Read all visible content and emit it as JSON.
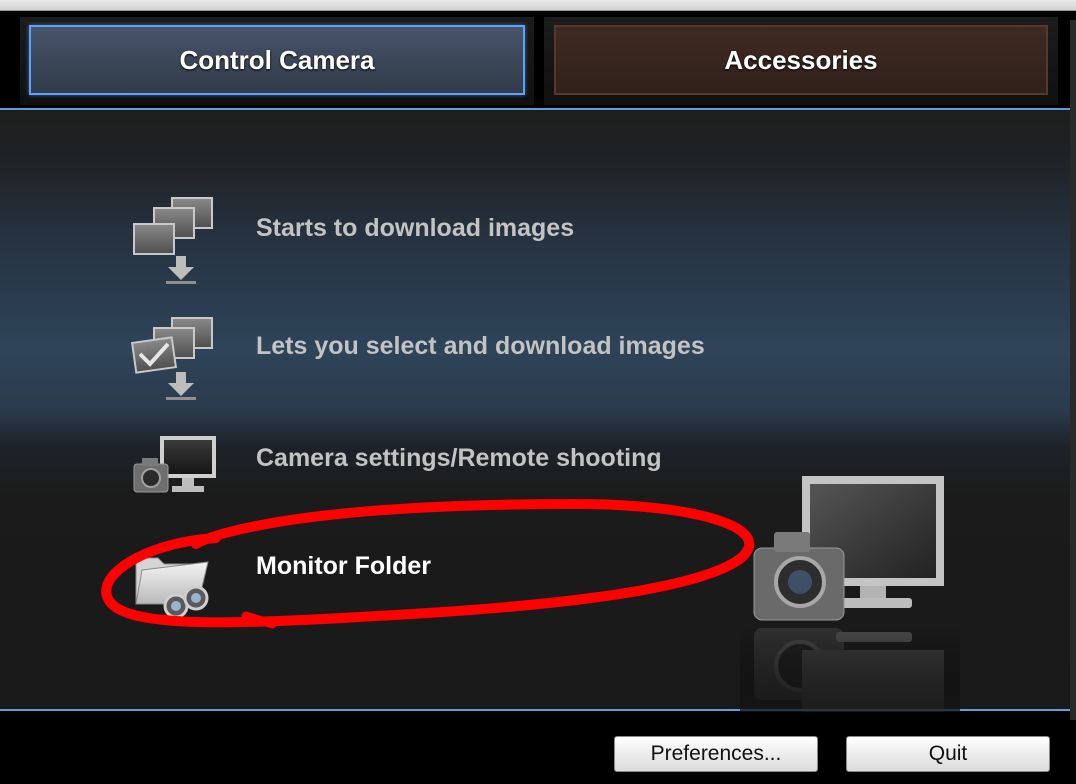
{
  "tabs": {
    "control_camera": "Control Camera",
    "accessories": "Accessories",
    "active": "control_camera"
  },
  "menu": {
    "items": [
      {
        "label": "Starts to download images",
        "icon": "download-images-icon"
      },
      {
        "label": "Lets you select and download images",
        "icon": "select-download-icon"
      },
      {
        "label": "Camera settings/Remote shooting",
        "icon": "remote-shooting-icon"
      },
      {
        "label": "Monitor Folder",
        "icon": "monitor-folder-icon"
      }
    ]
  },
  "buttons": {
    "preferences": "Preferences...",
    "quit": "Quit"
  },
  "colors": {
    "accent": "#5aa2ff",
    "annotation": "#ff0000"
  }
}
